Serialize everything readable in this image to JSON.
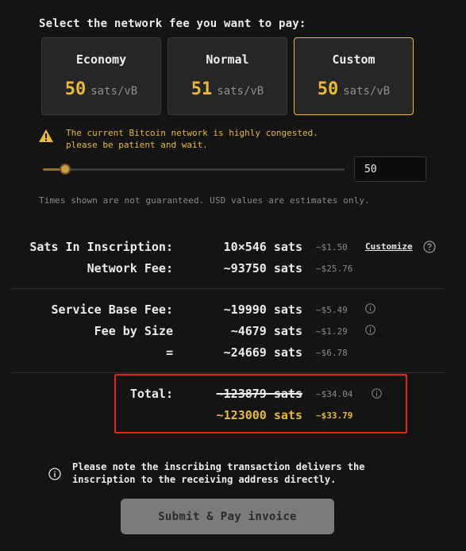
{
  "fee_selector": {
    "heading": "Select the network fee you want to pay:",
    "options": [
      {
        "name": "Economy",
        "rate": "50",
        "unit": "sats/vB"
      },
      {
        "name": "Normal",
        "rate": "51",
        "unit": "sats/vB"
      },
      {
        "name": "Custom",
        "rate": "50",
        "unit": "sats/vB"
      }
    ],
    "selected": "Custom",
    "warning_line1": "The current Bitcoin network is highly congested.",
    "warning_line2": "please be patient and wait.",
    "slider_value": 50,
    "custom_fee_value": "50",
    "disclaimer": "Times shown are not guaranteed. USD values are estimates only."
  },
  "summary": {
    "inscription": {
      "label": "Sats In Inscription:",
      "value": "10×546 sats",
      "usd": "~$1.50",
      "customize": "Customize"
    },
    "network_fee": {
      "label": "Network Fee:",
      "value": "~93750 sats",
      "usd": "~$25.76"
    },
    "service_base_fee": {
      "label": "Service Base Fee:",
      "value": "~19990 sats",
      "usd": "~$5.49"
    },
    "fee_by_size": {
      "label": "Fee by Size",
      "value": "~4679 sats",
      "usd": "~$1.29"
    },
    "subtotal": {
      "label": "=",
      "value": "~24669 sats",
      "usd": "~$6.78"
    },
    "total": {
      "label": "Total:",
      "original_value": "~123879 sats",
      "original_usd": "~$34.04",
      "discounted_value": "~123000 sats",
      "discounted_usd": "~$33.79"
    }
  },
  "note": {
    "line1": "Please note the inscribing transaction delivers the",
    "line2": "inscription to the receiving address directly."
  },
  "submit_label": "Submit & Pay invoice",
  "colors": {
    "accent": "#e8b93c",
    "highlight_box": "#e0251b",
    "background": "#141414"
  }
}
